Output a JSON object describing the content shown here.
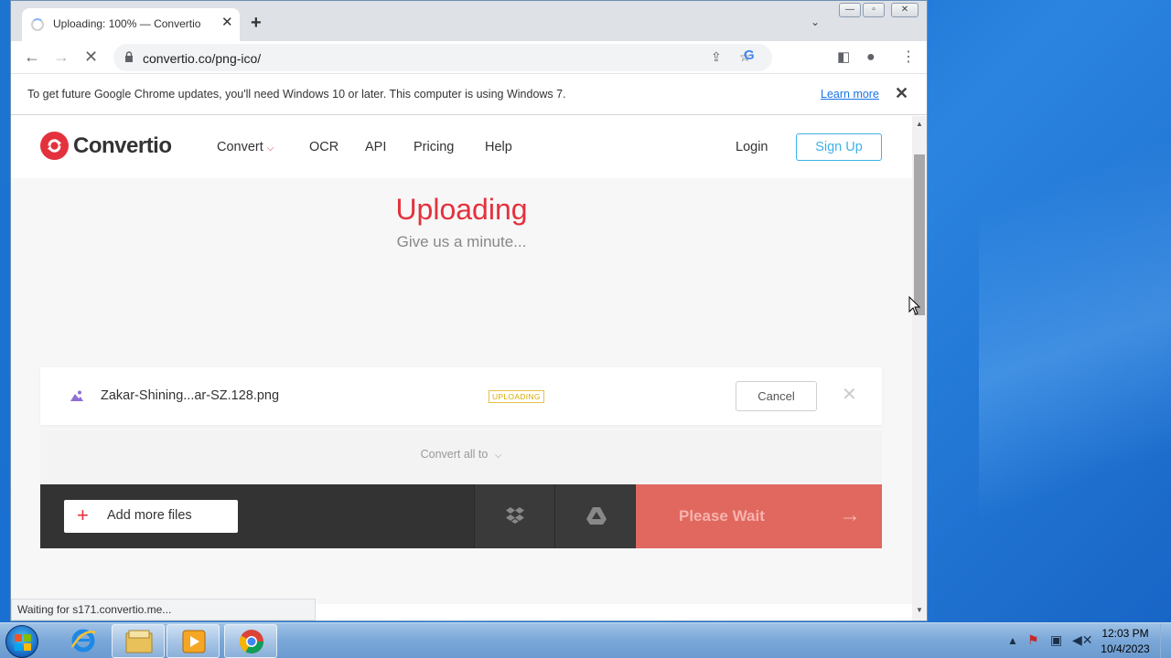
{
  "browser": {
    "tab_title": "Uploading: 100% — Convertio",
    "url": "convertio.co/png-ico/",
    "status_text": "Waiting for s171.convertio.me..."
  },
  "infobar": {
    "message": "To get future Google Chrome updates, you'll need Windows 10 or later. This computer is using Windows 7.",
    "learn_more": "Learn more"
  },
  "site": {
    "logo": "Convertio",
    "nav": {
      "convert": "Convert",
      "ocr": "OCR",
      "api": "API",
      "pricing": "Pricing",
      "help": "Help"
    },
    "login": "Login",
    "signup": "Sign Up"
  },
  "upload": {
    "title": "Uploading",
    "subtitle": "Give us a minute...",
    "file_name": "Zakar-Shining...ar-SZ.128.png",
    "status": "UPLOADING",
    "cancel": "Cancel",
    "convert_all": "Convert all to",
    "add_more": "Add more files",
    "please_wait": "Please Wait"
  },
  "taskbar": {
    "time": "12:03 PM",
    "date": "10/4/2023"
  },
  "colors": {
    "brand_red": "#e3323d",
    "signup_blue": "#3db2e8",
    "wait_button": "#e0685f",
    "badge_yellow": "#d9a900"
  }
}
